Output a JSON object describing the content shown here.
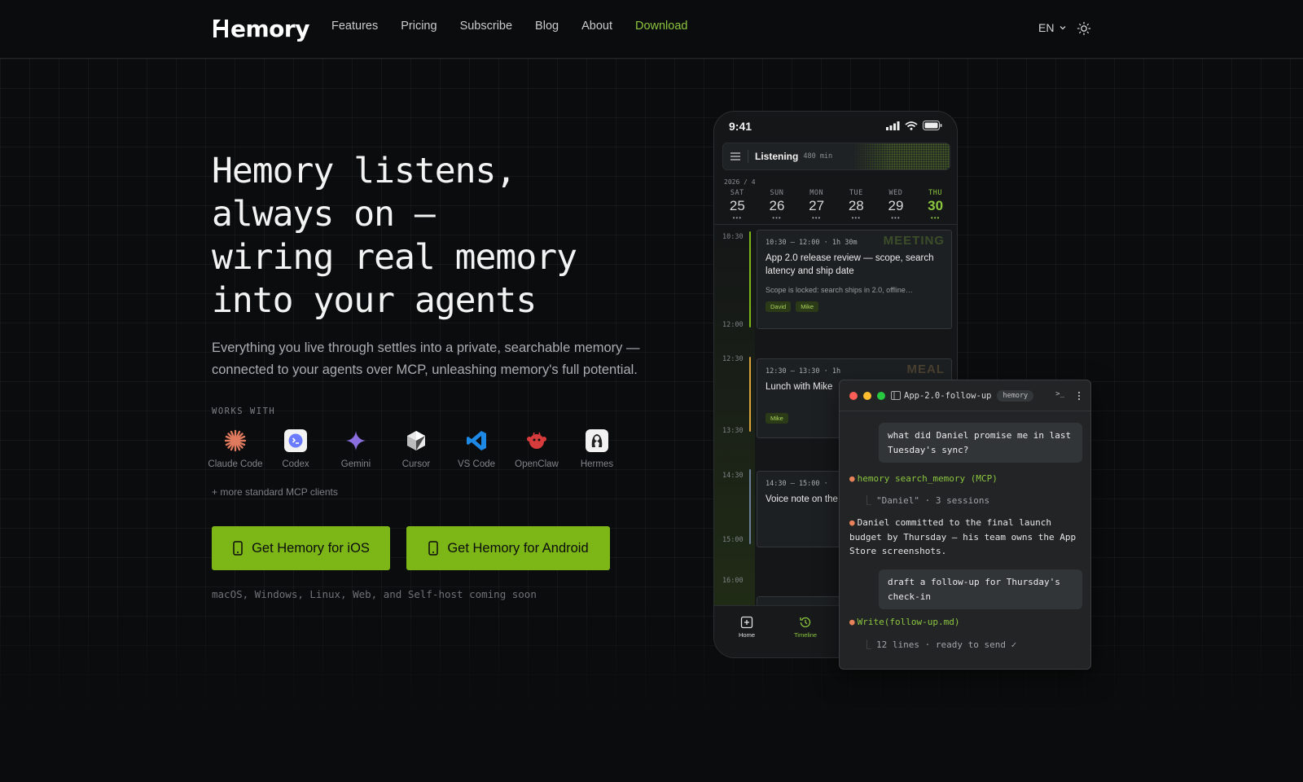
{
  "nav": {
    "logo": "Hemory",
    "links": [
      "Features",
      "Pricing",
      "Subscribe",
      "Blog",
      "About",
      "Download"
    ],
    "lang": "EN",
    "theme_icon": "sun-icon",
    "accent": "#8cc63f"
  },
  "hero": {
    "title_lines": [
      "Hemory listens,",
      "always on —",
      "wiring real memory",
      "into your agents"
    ],
    "subtitle": "Everything you live through settles into a private, searchable memory — connected to your agents over MCP, unleashing memory's full potential.",
    "works_with_label": "WORKS WITH",
    "clients": [
      "Claude Code",
      "Codex",
      "Gemini",
      "Cursor",
      "VS Code",
      "OpenClaw",
      "Hermes"
    ],
    "more_clients": "+ more standard MCP clients",
    "ios_button": "Get Hemory for iOS",
    "android_button": "Get Hemory for Android",
    "coming_soon": "macOS, Windows, Linux, Web, and Self-host coming soon",
    "button_color": "#7cb617"
  },
  "phone": {
    "time": "9:41",
    "listening": "Listening",
    "listening_minutes": "480 min",
    "month": "2026 / 4",
    "days": [
      {
        "weekday": "SAT",
        "num": "25"
      },
      {
        "weekday": "SUN",
        "num": "26"
      },
      {
        "weekday": "MON",
        "num": "27"
      },
      {
        "weekday": "TUE",
        "num": "28"
      },
      {
        "weekday": "WED",
        "num": "29"
      },
      {
        "weekday": "THU",
        "num": "30"
      }
    ],
    "active_day": "30",
    "times": [
      "10:30",
      "12:00",
      "12:30",
      "13:30",
      "14:30",
      "15:00",
      "16:00"
    ],
    "events": [
      {
        "tag": "MEETING",
        "time": "10:30 – 12:00 · 1h 30m",
        "title": "App 2.0 release review — scope, search latency and ship date",
        "desc": "Scope is locked: search ships in 2.0, offline…",
        "people": [
          "David",
          "Mike"
        ]
      },
      {
        "tag": "MEAL",
        "time": "12:30 – 13:30 · 1h",
        "title": "Lunch with Mike",
        "people": [
          "Mike"
        ]
      },
      {
        "time": "14:30 – 15:00 ·",
        "title": "Voice note on the"
      }
    ],
    "tabs": [
      "Home",
      "Timeline"
    ]
  },
  "terminal": {
    "title": "App-2.0-follow-up",
    "badge": "hemory",
    "prompt_icon": ">_",
    "user_msg_1": "what did Daniel promise me in last Tuesday's sync?",
    "tool_call": "hemory search_memory (MCP)",
    "tool_result": "\"Daniel\" · 3 sessions",
    "answer": "Daniel committed to the final launch budget by Thursday — his team owns the App Store screenshots.",
    "user_msg_2": "draft a follow-up for Thursday's check-in",
    "write_call": "Write(follow-up.md)",
    "write_result": "12 lines · ready to send ✓"
  }
}
